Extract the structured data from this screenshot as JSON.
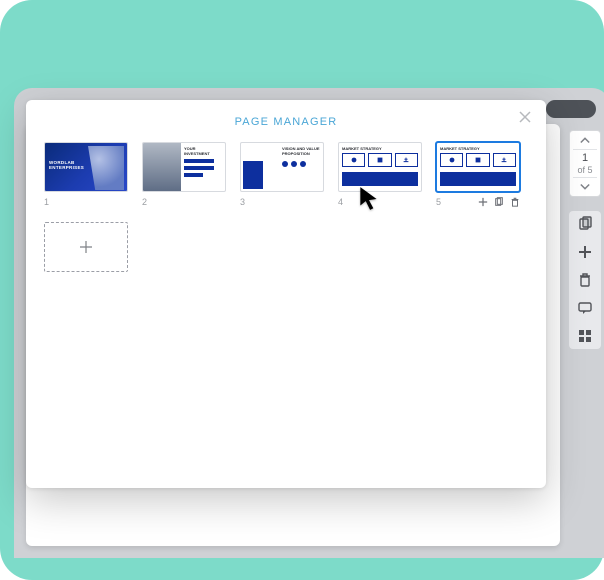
{
  "modal": {
    "title": "PAGE MANAGER"
  },
  "pager": {
    "current": "1",
    "total_label": "of 5"
  },
  "slides": [
    {
      "index": "1",
      "title": "WORDLAB ENTERPRISES"
    },
    {
      "index": "2",
      "title": "YOUR INVESTMENT"
    },
    {
      "index": "3",
      "title": "VISION AND VALUE PROPOSITION"
    },
    {
      "index": "4",
      "title": "MARKET STRATEGY"
    },
    {
      "index": "5",
      "title": "MARKET STRATEGY",
      "selected": true
    }
  ],
  "colors": {
    "brand_blue": "#0d2f9e",
    "accent_link": "#4aa6d6",
    "stage_bg": "#7ddbc9"
  }
}
